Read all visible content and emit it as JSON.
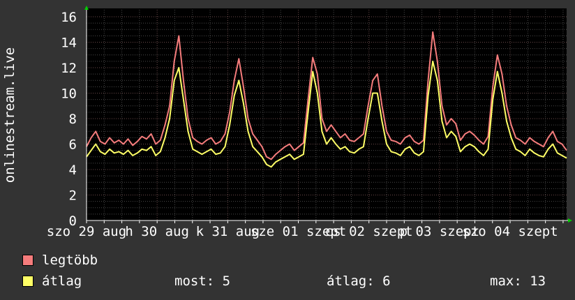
{
  "chart_data": {
    "type": "line",
    "ylabel": "onlinestream.live",
    "ylim": [
      0,
      16
    ],
    "yticks": [
      "0",
      "2",
      "4",
      "6",
      "8",
      "10",
      "12",
      "14",
      "16"
    ],
    "xtick_labels": [
      "szo 29 aug",
      "h 30 aug",
      "k 31 aug",
      "sze 01 szept",
      "cs 02 szept",
      "p 03 szept",
      "szo 04 szept"
    ],
    "colors": {
      "background": "#333333",
      "plot": "#000000",
      "grid": "#4a4a4a",
      "axis": "#ffffff",
      "arrow": "#00cc00"
    },
    "series": [
      {
        "name": "legtöbb",
        "color": "#f57c7c",
        "values": [
          5.8,
          6.5,
          7.0,
          6.2,
          6.0,
          6.5,
          6.1,
          6.3,
          6.0,
          6.4,
          5.9,
          6.2,
          6.6,
          6.4,
          6.8,
          6.0,
          6.3,
          7.5,
          9.0,
          12.5,
          14.5,
          11.0,
          8.0,
          6.5,
          6.2,
          6.0,
          6.3,
          6.5,
          6.0,
          6.2,
          6.8,
          8.5,
          11.0,
          12.7,
          10.5,
          8.0,
          6.8,
          6.3,
          5.8,
          5.0,
          4.8,
          5.2,
          5.5,
          5.8,
          6.0,
          5.5,
          5.8,
          6.1,
          9.5,
          12.8,
          11.5,
          8.0,
          7.0,
          7.5,
          7.0,
          6.5,
          6.8,
          6.3,
          6.2,
          6.5,
          6.8,
          9.0,
          11.0,
          11.5,
          9.0,
          7.0,
          6.3,
          6.2,
          6.0,
          6.5,
          6.7,
          6.2,
          6.0,
          6.3,
          11.0,
          14.8,
          12.5,
          9.0,
          7.5,
          8.0,
          7.6,
          6.3,
          6.8,
          7.0,
          6.7,
          6.3,
          6.0,
          6.6,
          10.5,
          13.0,
          11.5,
          9.0,
          7.5,
          6.5,
          6.3,
          6.0,
          6.5,
          6.2,
          6.0,
          5.8,
          6.5,
          7.0,
          6.2,
          6.0,
          5.5
        ]
      },
      {
        "name": "átlag",
        "color": "#ffff66",
        "values": [
          5.0,
          5.5,
          6.0,
          5.4,
          5.2,
          5.6,
          5.3,
          5.4,
          5.2,
          5.5,
          5.1,
          5.3,
          5.6,
          5.5,
          5.8,
          5.1,
          5.4,
          6.5,
          8.0,
          11.0,
          12.0,
          9.5,
          7.0,
          5.6,
          5.4,
          5.2,
          5.4,
          5.6,
          5.2,
          5.3,
          5.8,
          7.5,
          9.8,
          11.0,
          9.2,
          7.0,
          5.8,
          5.4,
          5.0,
          4.4,
          4.2,
          4.6,
          4.8,
          5.0,
          5.2,
          4.8,
          5.0,
          5.2,
          8.5,
          11.7,
          10.0,
          7.0,
          6.0,
          6.5,
          6.0,
          5.6,
          5.8,
          5.4,
          5.3,
          5.6,
          5.8,
          8.0,
          10.0,
          10.0,
          7.8,
          6.0,
          5.4,
          5.3,
          5.1,
          5.6,
          5.8,
          5.3,
          5.1,
          5.4,
          9.8,
          12.5,
          11.0,
          7.8,
          6.5,
          7.0,
          6.6,
          5.4,
          5.8,
          6.0,
          5.8,
          5.4,
          5.1,
          5.6,
          9.5,
          11.7,
          10.0,
          7.8,
          6.5,
          5.6,
          5.4,
          5.1,
          5.6,
          5.3,
          5.1,
          5.0,
          5.6,
          6.0,
          5.3,
          5.1,
          4.9
        ]
      }
    ]
  },
  "stats": {
    "now_label": "most: 5",
    "avg_label": "átlag: 6",
    "max_label": "max: 13"
  }
}
